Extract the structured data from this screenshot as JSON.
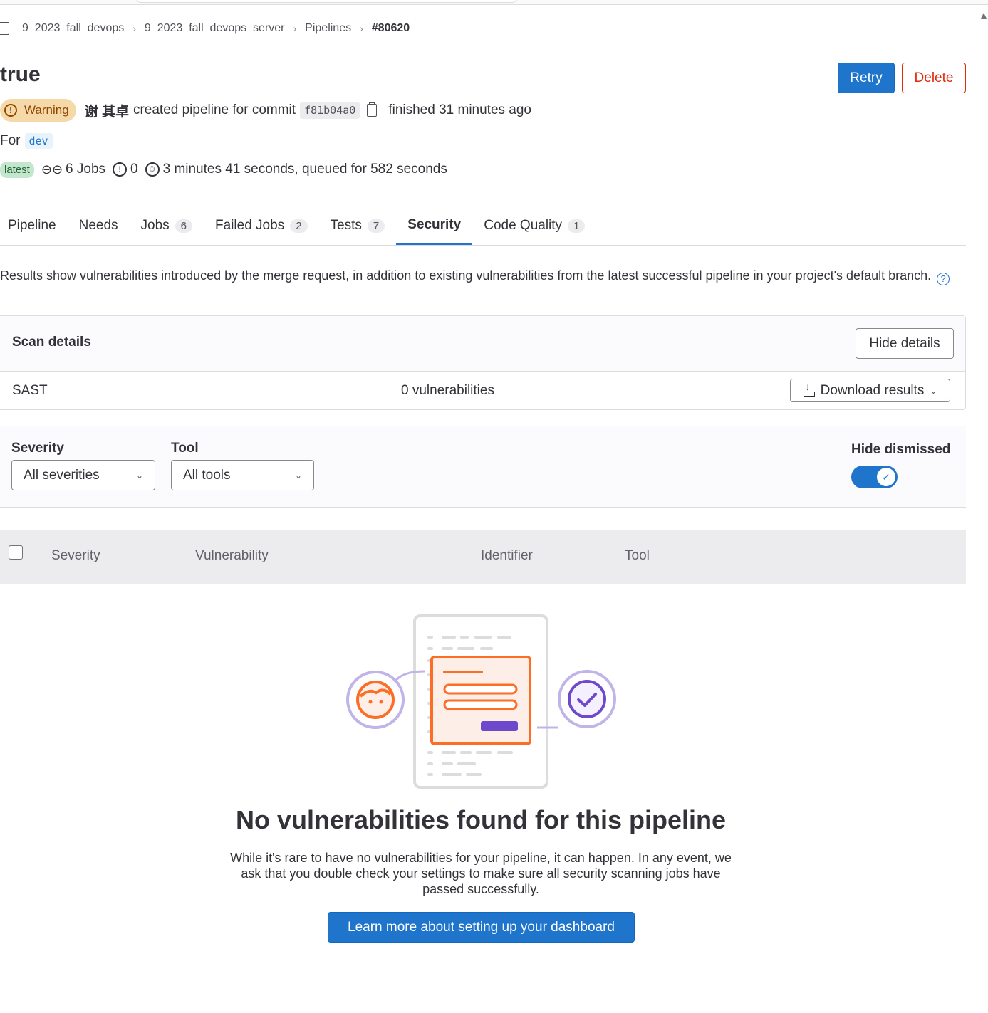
{
  "breadcrumb": {
    "items": [
      "9_2023_fall_devops",
      "9_2023_fall_devops_server",
      "Pipelines"
    ],
    "current": "#80620"
  },
  "header": {
    "title": "true",
    "retry_label": "Retry",
    "delete_label": "Delete"
  },
  "pipeline": {
    "status": "Warning",
    "author": "谢 其卓",
    "created_text": "created pipeline for commit",
    "commit_sha": "f81b04a0",
    "finished_text": "finished 31 minutes ago",
    "for_label": "For",
    "branch": "dev",
    "latest_badge": "latest",
    "jobs_text": "6 Jobs",
    "failed_count": "0",
    "duration_text": "3 minutes 41 seconds, queued for 582 seconds"
  },
  "tabs": [
    {
      "label": "Pipeline",
      "count": ""
    },
    {
      "label": "Needs",
      "count": ""
    },
    {
      "label": "Jobs",
      "count": "6"
    },
    {
      "label": "Failed Jobs",
      "count": "2"
    },
    {
      "label": "Tests",
      "count": "7"
    },
    {
      "label": "Security",
      "count": ""
    },
    {
      "label": "Code Quality",
      "count": "1"
    }
  ],
  "info_text": "Results show vulnerabilities introduced by the merge request, in addition to existing vulnerabilities from the latest successful pipeline in your project's default branch.",
  "scan": {
    "title": "Scan details",
    "hide_label": "Hide details",
    "type": "SAST",
    "vulnerabilities": "0 vulnerabilities",
    "download_label": "Download results"
  },
  "filters": {
    "severity_label": "Severity",
    "severity_value": "All severities",
    "tool_label": "Tool",
    "tool_value": "All tools",
    "dismissed_label": "Hide dismissed",
    "dismissed_on": true
  },
  "table": {
    "headers": [
      "Severity",
      "Vulnerability",
      "Identifier",
      "Tool"
    ]
  },
  "empty_state": {
    "title": "No vulnerabilities found for this pipeline",
    "text": "While it's rare to have no vulnerabilities for your pipeline, it can happen. In any event, we ask that you double check your settings to make sure all security scanning jobs have passed successfully.",
    "button_label": "Learn more about setting up your dashboard"
  },
  "colors": {
    "primary": "#1f75cb",
    "danger": "#dd2b0e",
    "warning_bg": "#f5d9a8",
    "illustration_orange": "#fc6d26",
    "illustration_purple": "#6e49cb"
  },
  "icons": [
    "project-icon",
    "chevron-right-icon",
    "warning-icon",
    "copy-icon",
    "pipeline-icon",
    "failed-icon",
    "timer-icon",
    "help-icon",
    "download-icon",
    "chevron-down-icon",
    "check-icon"
  ]
}
